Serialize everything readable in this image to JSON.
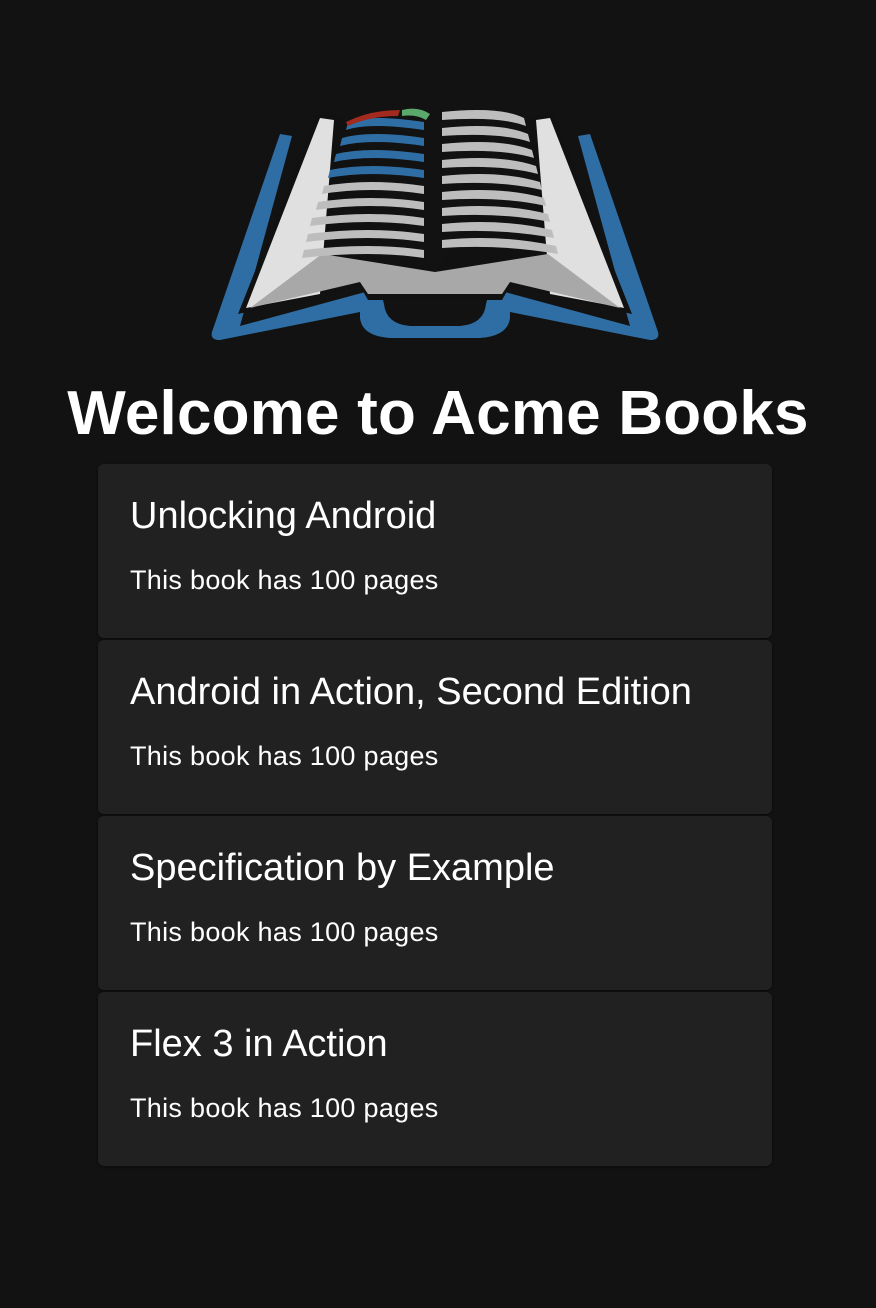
{
  "logo": {
    "icon": "open-book-icon",
    "colors": {
      "cover": "#2f6ea4",
      "pages": "#d9d9d9",
      "page_lines": "#c8c8c8",
      "text_lines_highlight": "#2f6ea4",
      "bookmark_red": "#a22a1e",
      "bookmark_green": "#5aa86a"
    }
  },
  "page_title": "Welcome to Acme Books",
  "books": [
    {
      "title": "Unlocking Android",
      "pages_text": "This book has 100 pages"
    },
    {
      "title": "Android in Action, Second Edition",
      "pages_text": "This book has 100 pages"
    },
    {
      "title": "Specification by Example",
      "pages_text": "This book has 100 pages"
    },
    {
      "title": "Flex 3 in Action",
      "pages_text": "This book has 100 pages"
    }
  ],
  "colors": {
    "background": "#121212",
    "card": "#212121",
    "text": "#ffffff"
  }
}
